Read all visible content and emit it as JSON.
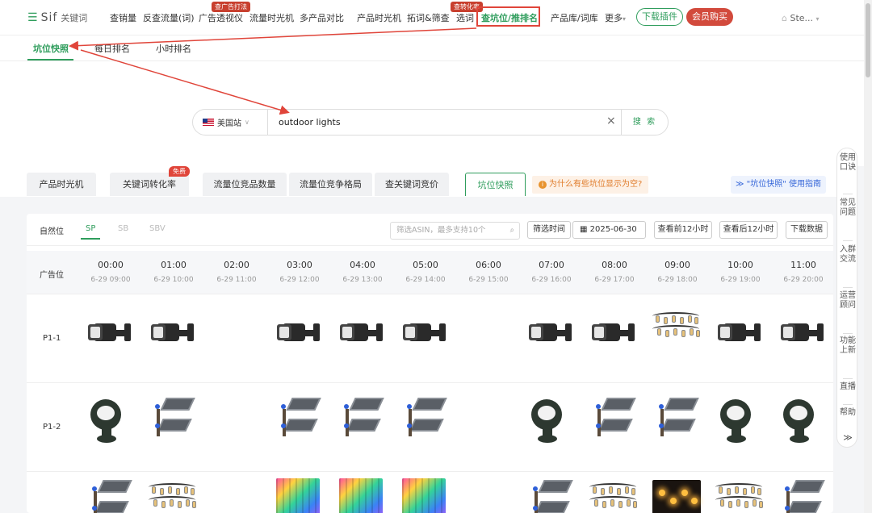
{
  "logo": {
    "brand": "Sif",
    "sub": "关键词"
  },
  "nav": {
    "items": [
      "查销量",
      "反查流量(词)",
      "广告透视仪",
      "流量时光机",
      "多产品对比",
      "产品时光机",
      "拓词&筛查",
      "选词",
      "查坑位/推排名",
      "产品库/词库",
      "更多"
    ],
    "badge_ad": "查广告打法",
    "badge_conv": "查转化率",
    "download": "下载插件",
    "vip": "会员购买",
    "user": "Ste..."
  },
  "subtabs": [
    "坑位快照",
    "每日排名",
    "小时排名"
  ],
  "search": {
    "site": "美国站",
    "query": "outdoor lights",
    "button": "搜 索"
  },
  "ftabs": {
    "items": [
      "产品时光机",
      "关键词转化率",
      "流量位竞品数量",
      "流量位竞争格局",
      "查关键词竞价",
      "坑位快照"
    ],
    "free_badge": "免费",
    "why": "为什么有些坑位显示为空?",
    "guide": "\"坑位快照\" 使用指南"
  },
  "toolbar": {
    "natural": "自然位",
    "sp": "SP",
    "sb": "SB",
    "sbv": "SBV",
    "filter_placeholder": "筛选ASIN，最多支持10个",
    "filter_time": "筛选时间",
    "date": "2025-06-30",
    "prev12": "查看前12小时",
    "next12": "查看后12小时",
    "download": "下载数据"
  },
  "table": {
    "header_label": "广告位",
    "columns": [
      {
        "time": "00:00",
        "date": "6-29 09:00"
      },
      {
        "time": "01:00",
        "date": "6-29 10:00"
      },
      {
        "time": "02:00",
        "date": "6-29 11:00"
      },
      {
        "time": "03:00",
        "date": "6-29 12:00"
      },
      {
        "time": "04:00",
        "date": "6-29 13:00"
      },
      {
        "time": "05:00",
        "date": "6-29 14:00"
      },
      {
        "time": "06:00",
        "date": "6-29 15:00"
      },
      {
        "time": "07:00",
        "date": "6-29 16:00"
      },
      {
        "time": "08:00",
        "date": "6-29 17:00"
      },
      {
        "time": "09:00",
        "date": "6-29 18:00"
      },
      {
        "time": "10:00",
        "date": "6-29 19:00"
      },
      {
        "time": "11:00",
        "date": "6-29 20:00"
      }
    ],
    "rows": [
      {
        "label": "P1-1",
        "cells": [
          "flood",
          "flood",
          "",
          "flood",
          "flood",
          "flood",
          "",
          "flood",
          "flood",
          "string",
          "flood",
          "flood"
        ]
      },
      {
        "label": "P1-2",
        "cells": [
          "spot",
          "street",
          "",
          "street",
          "street",
          "street",
          "",
          "spot",
          "street",
          "street",
          "spot",
          "spot"
        ]
      },
      {
        "label": "",
        "cells": [
          "street",
          "string",
          "",
          "rgb",
          "rgb",
          "rgb",
          "",
          "street",
          "string",
          "garden",
          "string",
          "street"
        ]
      }
    ]
  },
  "rsb": [
    "使用口诀",
    "常见问题",
    "入群交流",
    "运营顾问",
    "功能上新",
    "直播",
    "帮助"
  ],
  "colors": {
    "accent": "#2f9d5c",
    "red": "#d24a3c",
    "highlight_box": "#e0453a"
  }
}
